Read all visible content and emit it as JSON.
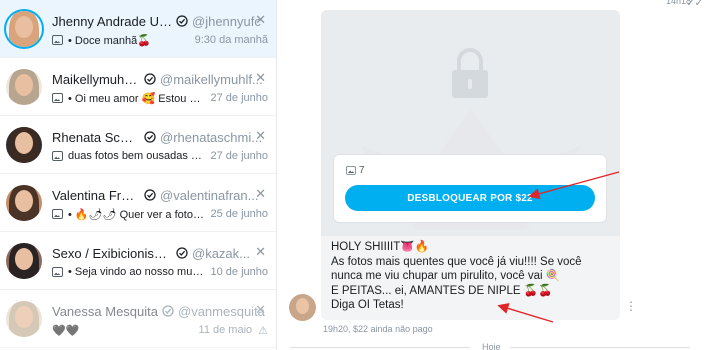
{
  "chats": [
    {
      "name": "Jhenny Andrade UFC",
      "handle": "@jhennyufc",
      "preview": "• Doce manhã🍒",
      "time": "9:30 da manhã",
      "avatar_colors": [
        "#d9a37c",
        "#f3d6c2"
      ]
    },
    {
      "name": "Maikellymuhlf...",
      "handle": "@maikellymuhlf...",
      "preview": "• Oi meu amor 🥰 Estou apr...",
      "time": "27 de junho",
      "avatar_colors": [
        "#b8a58f",
        "#efe7dc"
      ]
    },
    {
      "name": "Rhenata Schmi...",
      "handle": "@rhenataschmi...",
      "preview": "duas fotos bem ousadas pa...",
      "time": "27 de junho",
      "avatar_colors": [
        "#3a2a22",
        "#2c2c2c"
      ]
    },
    {
      "name": "Valentina Fran...",
      "handle": "@valentinafran...",
      "preview": "• 🔥🌶🌶 Quer ver a foto no...",
      "time": "25 de junho",
      "avatar_colors": [
        "#4a3428",
        "#c78d6a"
      ]
    },
    {
      "name": "Sexo / Exibicionismo /...",
      "handle": "@kazak...",
      "preview": "• Seja vindo ao nosso mund...",
      "time": "10 de junho",
      "avatar_colors": [
        "#2a2324",
        "#8b6a5f"
      ]
    },
    {
      "name": "Vanessa Mesquita",
      "handle": "@vanmesquita",
      "preview": "🖤🖤",
      "time": "11 de maio",
      "avatar_colors": [
        "#c7b49a",
        "#e8dccb"
      ]
    }
  ],
  "conversation": {
    "top_time": "14h18",
    "media_count": "7",
    "unlock_label": "DESBLOQUEAR POR $22",
    "message": "HOLY SHIIIIT👅🔥\nAs fotos mais quentes que você já viu!!!! Se você nunca me viu chupar um pirulito, você vai 🍭\nE PEITAS... ei, AMANTES DE NIPLE 🍒🍒\nDiga OI Tetas!",
    "meta": "19h20, $22 ainda não pago",
    "divider_label": "Hoje"
  },
  "colors": {
    "accent": "#00aff0",
    "annotation_arrow": "#e0262a"
  }
}
